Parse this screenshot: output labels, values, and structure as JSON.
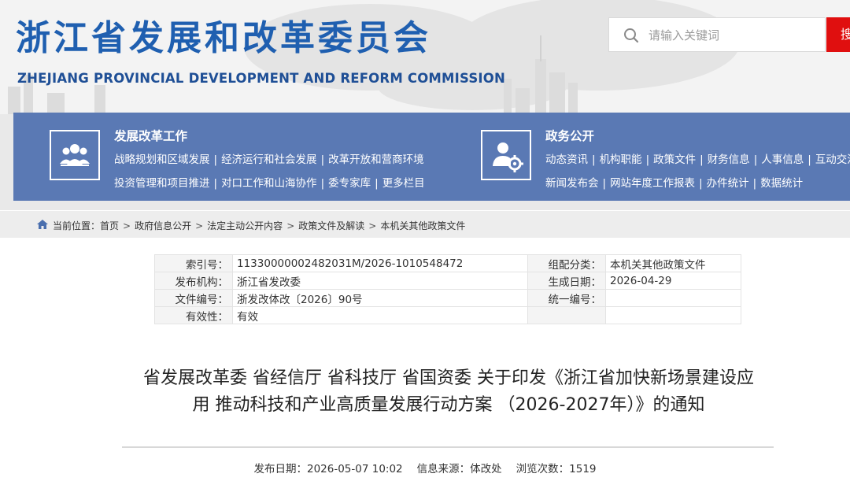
{
  "header": {
    "title": "浙江省发展和改革委员会",
    "title_en": "ZHEJIANG PROVINCIAL DEVELOPMENT AND REFORM COMMISSION",
    "search_placeholder": "请输入关键词",
    "search_button": "搜"
  },
  "nav": [
    {
      "title": "发展改革工作",
      "icon": "people-group-icon",
      "lines": [
        [
          "战略规划和区域发展",
          "经济运行和社会发展",
          "改革开放和营商环境"
        ],
        [
          "投资管理和项目推进",
          "对口工作和山海协作",
          "委专家库",
          "更多栏目"
        ]
      ]
    },
    {
      "title": "政务公开",
      "icon": "user-settings-icon",
      "lines": [
        [
          "动态资讯",
          "机构职能",
          "政策文件",
          "财务信息",
          "人事信息",
          "互动交流"
        ],
        [
          "新闻发布会",
          "网站年度工作报表",
          "办件统计",
          "数据统计"
        ]
      ]
    }
  ],
  "breadcrumb": {
    "label": "当前位置：",
    "items": [
      "首页",
      "政府信息公开",
      "法定主动公开内容",
      "政策文件及解读",
      "本机关其他政策文件"
    ],
    "separator": ">"
  },
  "meta": {
    "index_no_label": "索引号：",
    "index_no": "11330000002482031M/2026-1010548472",
    "category_label": "组配分类：",
    "category": "本机关其他政策文件",
    "issuer_label": "发布机构：",
    "issuer": "浙江省发改委",
    "created_label": "生成日期：",
    "created": "2026-04-29",
    "doc_no_label": "文件编号：",
    "doc_no": "浙发改体改〔2026〕90号",
    "unified_no_label": "统一编号：",
    "unified_no": "",
    "validity_label": "有效性：",
    "validity": "有效"
  },
  "document": {
    "title_line1": "省发展改革委 省经信厅 省科技厅 省国资委 关于印发《浙江省加快新场景建设应",
    "title_line2": "用 推动科技和产业高质量发展行动方案 （2026-2027年）》的通知",
    "publish_date_label": "发布日期：",
    "publish_date": "2026-05-07 10:02",
    "source_label": "信息来源：",
    "source": "体改处",
    "views_label": "浏览次数：",
    "views": "1519"
  },
  "colors": {
    "brand_blue": "#1f5fb0",
    "nav_blue": "#5a79b4",
    "search_red": "#e00f0f"
  }
}
